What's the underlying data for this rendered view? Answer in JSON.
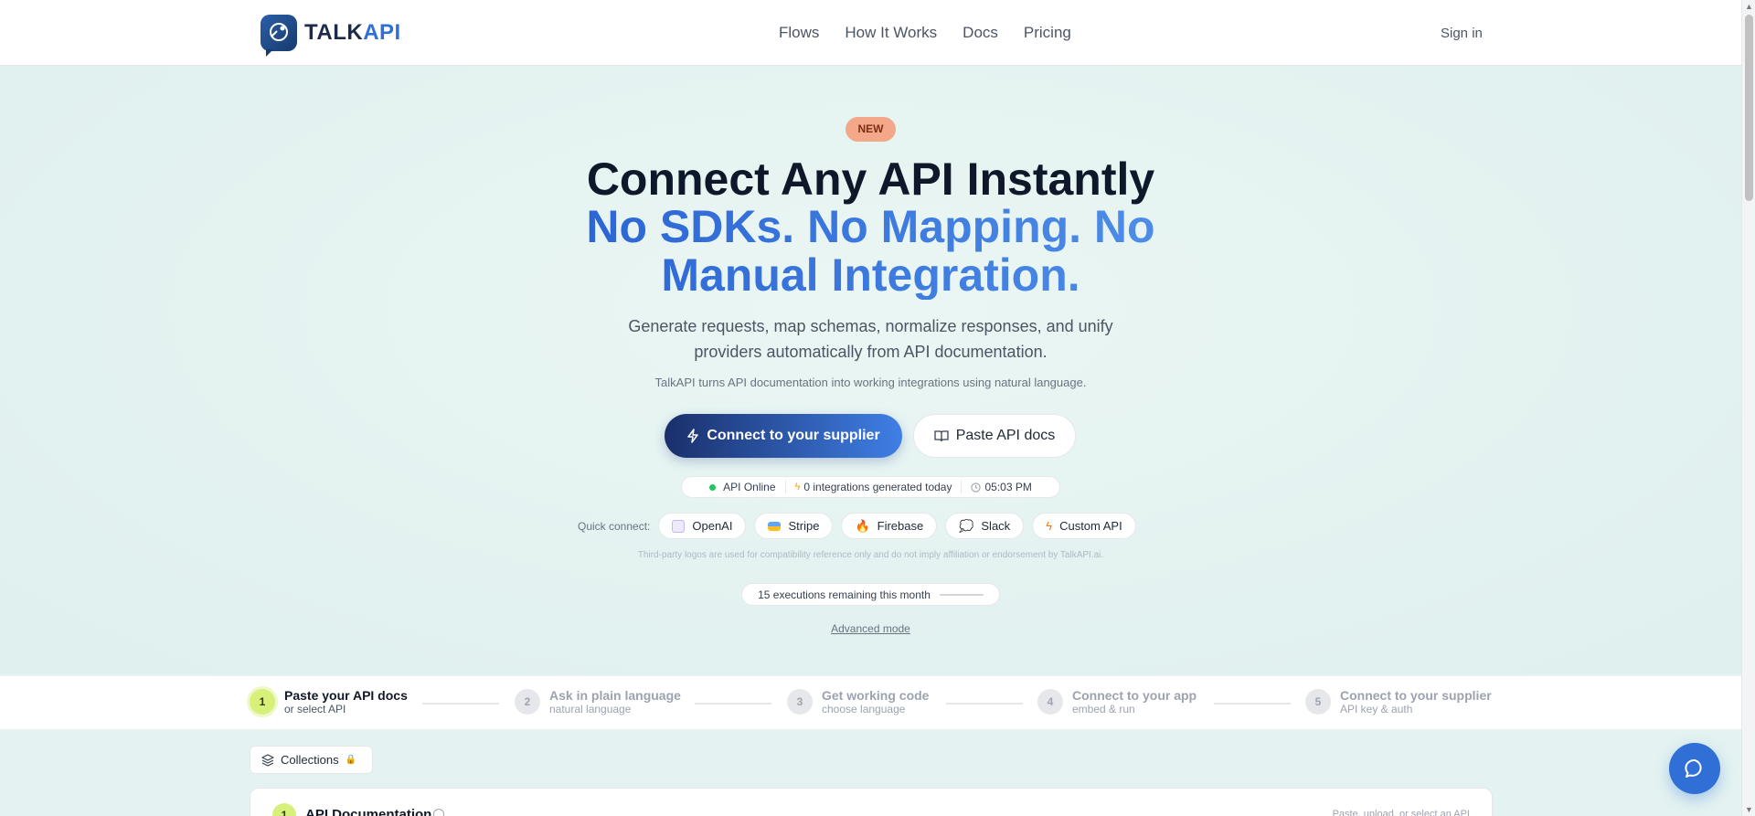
{
  "brand": {
    "name_part1": "TALK",
    "name_part2": "API"
  },
  "nav": {
    "items": [
      "Flows",
      "How It Works",
      "Docs",
      "Pricing"
    ],
    "signin": "Sign in"
  },
  "hero": {
    "badge": "NEW",
    "title": "Connect Any API Instantly",
    "title_accent": "No SDKs. No Mapping. No Manual Integration.",
    "subtitle": "Generate requests, map schemas, normalize responses, and unify providers automatically from API documentation.",
    "tagline": "TalkAPI turns API documentation into working integrations using natural language.",
    "primary_button": "Connect to your supplier",
    "secondary_button": "Paste API docs",
    "status": {
      "api": "API Online",
      "integrations": "0 integrations generated today",
      "time": "05:03 PM"
    },
    "quick_connect": {
      "label": "Quick connect:",
      "chips": [
        "OpenAI",
        "Stripe",
        "Firebase",
        "Slack",
        "Custom API"
      ]
    },
    "disclaimer": "Third-party logos are used for compatibility reference only and do not imply affiliation or endorsement by TalkAPI.ai.",
    "executions": "15 executions remaining this month",
    "advanced": "Advanced mode"
  },
  "steps": [
    {
      "num": "1",
      "title": "Paste your API docs",
      "sub": "or select API"
    },
    {
      "num": "2",
      "title": "Ask in plain language",
      "sub": "natural language"
    },
    {
      "num": "3",
      "title": "Get working code",
      "sub": "choose language"
    },
    {
      "num": "4",
      "title": "Connect to your app",
      "sub": "embed & run"
    },
    {
      "num": "5",
      "title": "Connect to your supplier",
      "sub": "API key & auth"
    }
  ],
  "collections": {
    "label": "Collections"
  },
  "card": {
    "num": "1",
    "title": "API Documentation",
    "right": "Paste, upload, or select an API"
  },
  "colors": {
    "accent": "#2f6fd6",
    "primary_dark": "#1a2f6b",
    "step_active": "#d6f07a",
    "badge": "#f3a88a"
  }
}
